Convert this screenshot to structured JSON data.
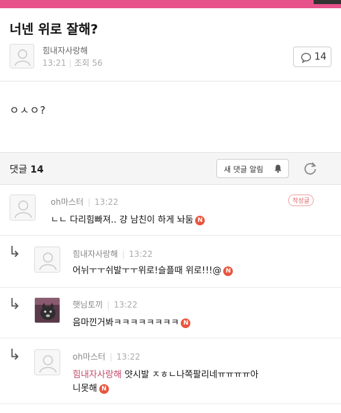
{
  "post": {
    "title": "너넨 위로 잘해?",
    "author": "힘내자사랑해",
    "time": "13:21",
    "views": "조회 56",
    "comment_count": "14",
    "body": "ㅇㅅㅇ?"
  },
  "comments_header": {
    "label": "댓글",
    "count": "14",
    "notify_label": "새 댓글 알림"
  },
  "comments": [
    {
      "author": "oh마스터",
      "time": "13:22",
      "text": "ㄴㄴ 다리힘빠져.. 걍 남친이 하게 놔둠",
      "badge": "N",
      "tag": "작성글"
    },
    {
      "author": "힘내자사랑해",
      "time": "13:22",
      "text": "어뉘ㅜㅜ쉬발ㅜㅜ위로!슬플때 위로!!!@",
      "badge": "N"
    },
    {
      "author": "햇님토끼",
      "time": "13:22",
      "text": "음마낀거봐ㅋㅋㅋㅋㅋㅋㅋㅋ",
      "badge": "N"
    },
    {
      "author": "oh마스터",
      "time": "13:22",
      "mention": "힘내자사랑해",
      "text": "얏시발 ㅈㅎㄴ나쪽팔리네ㅠㅠㅠㅠ아",
      "text2": "니못해",
      "badge": "N"
    }
  ],
  "icons": {
    "comment_bubble": "comment-bubble-icon",
    "bell": "bell-icon",
    "refresh": "refresh-icon",
    "reply": "reply-arrow-icon"
  },
  "colors": {
    "brand": "#e8528a",
    "badge": "#e8553e",
    "mention": "#c24a6a"
  }
}
